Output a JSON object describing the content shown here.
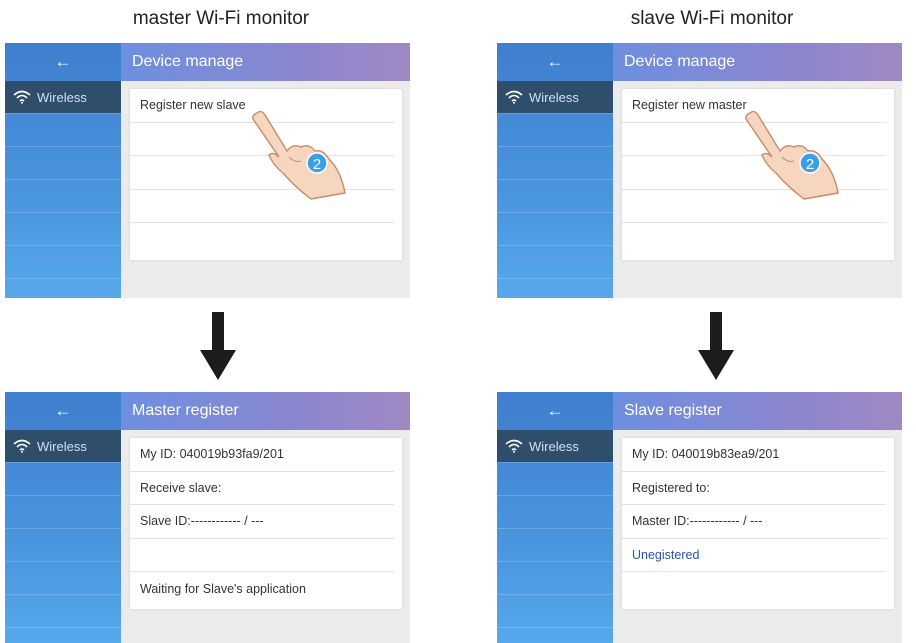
{
  "columns": {
    "left_title": "master Wi-Fi monitor",
    "right_title": "slave Wi-Fi monitor"
  },
  "common": {
    "back_glyph": "←",
    "sidebar_label": "Wireless",
    "sidebar_icon": "wifi-icon",
    "step_number": "2"
  },
  "screens": {
    "master_manage": {
      "header": "Device manage",
      "rows": [
        "Register new slave",
        "",
        "",
        "",
        ""
      ]
    },
    "slave_manage": {
      "header": "Device manage",
      "rows": [
        "Register new master",
        "",
        "",
        "",
        ""
      ]
    },
    "master_register": {
      "header": "Master register",
      "rows": [
        "My ID: 040019b93fa9/201",
        "Receive slave:",
        "Slave ID:------------ / ---",
        "",
        "Waiting for Slave's application"
      ]
    },
    "slave_register": {
      "header": "Slave register",
      "rows": [
        "My ID: 040019b83ea9/201",
        "Registered to:",
        "Master ID:------------ / ---",
        "Unegistered",
        ""
      ]
    }
  },
  "colors": {
    "sidebar_blue": "#4a95de",
    "header_purple": "#8a86cf",
    "selected_dark": "#2f4e6b",
    "status_blue": "#2a54a8"
  }
}
